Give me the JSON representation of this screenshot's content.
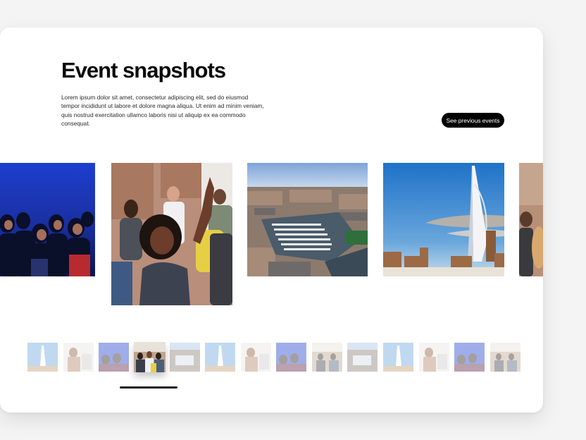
{
  "section": {
    "title": "Event snapshots",
    "description": "Lorem ipsum dolor sit amet, consectetur adipiscing elit, sed do eiusmod tempor incididunt ut labore et dolore magna aliqua. Ut enim ad minim veniam, quis nostrud exercitation ullamco laboris nisi ut aliquip ex ea commodo consequat.",
    "cta_label": "See previous events"
  },
  "carousel": {
    "slides": [
      {
        "subject": "conference-audience-photo"
      },
      {
        "subject": "woman-raising-hand-photo"
      },
      {
        "subject": "harbour-aerial-photo"
      },
      {
        "subject": "spinnaker-tower-photo"
      },
      {
        "subject": "seminar-partial-photo"
      }
    ],
    "active_thumbnail": 4,
    "thumbnail_count": 14
  },
  "colors": {
    "background": "#f4f4f5",
    "card": "#ffffff",
    "text": "#0b0b0b",
    "button": "#000000",
    "button_text": "#ffffff",
    "indicator": "#1a1a1a"
  }
}
